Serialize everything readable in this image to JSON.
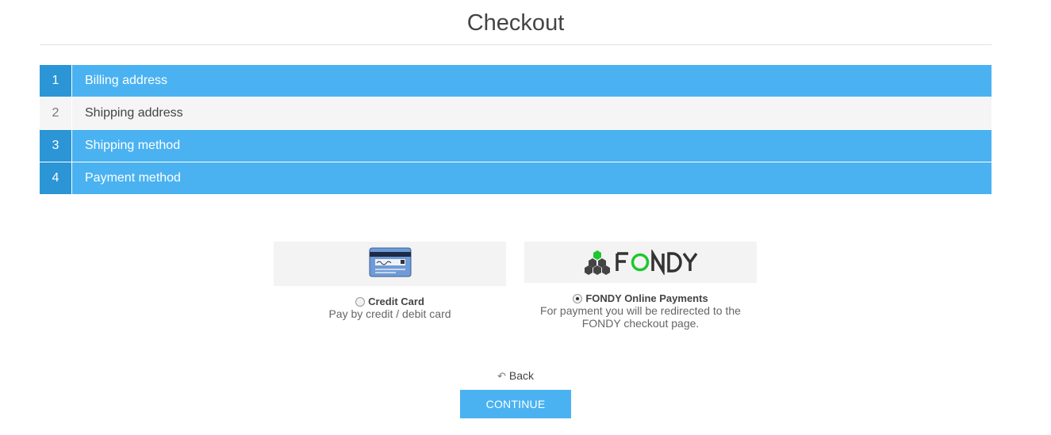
{
  "page": {
    "title": "Checkout"
  },
  "steps": [
    {
      "number": "1",
      "label": "Billing address",
      "state": "active"
    },
    {
      "number": "2",
      "label": "Shipping address",
      "state": "inactive"
    },
    {
      "number": "3",
      "label": "Shipping method",
      "state": "active"
    },
    {
      "number": "4",
      "label": "Payment method",
      "state": "active"
    }
  ],
  "payment_methods": [
    {
      "name": "Credit Card",
      "description": "Pay by credit / debit card",
      "selected": false,
      "logo": "credit-card-icon"
    },
    {
      "name": "FONDY Online Payments",
      "description": "For payment you will be redirected to the FONDY checkout page.",
      "selected": true,
      "logo": "fondy-logo",
      "logo_text": "FONDY"
    }
  ],
  "actions": {
    "back_label": "Back",
    "continue_label": "CONTINUE"
  },
  "colors": {
    "accent": "#4ab2f1",
    "accent_dark": "#2b95d6",
    "inactive_bg": "#f5f5f5",
    "fondy_green": "#1ec72f"
  }
}
